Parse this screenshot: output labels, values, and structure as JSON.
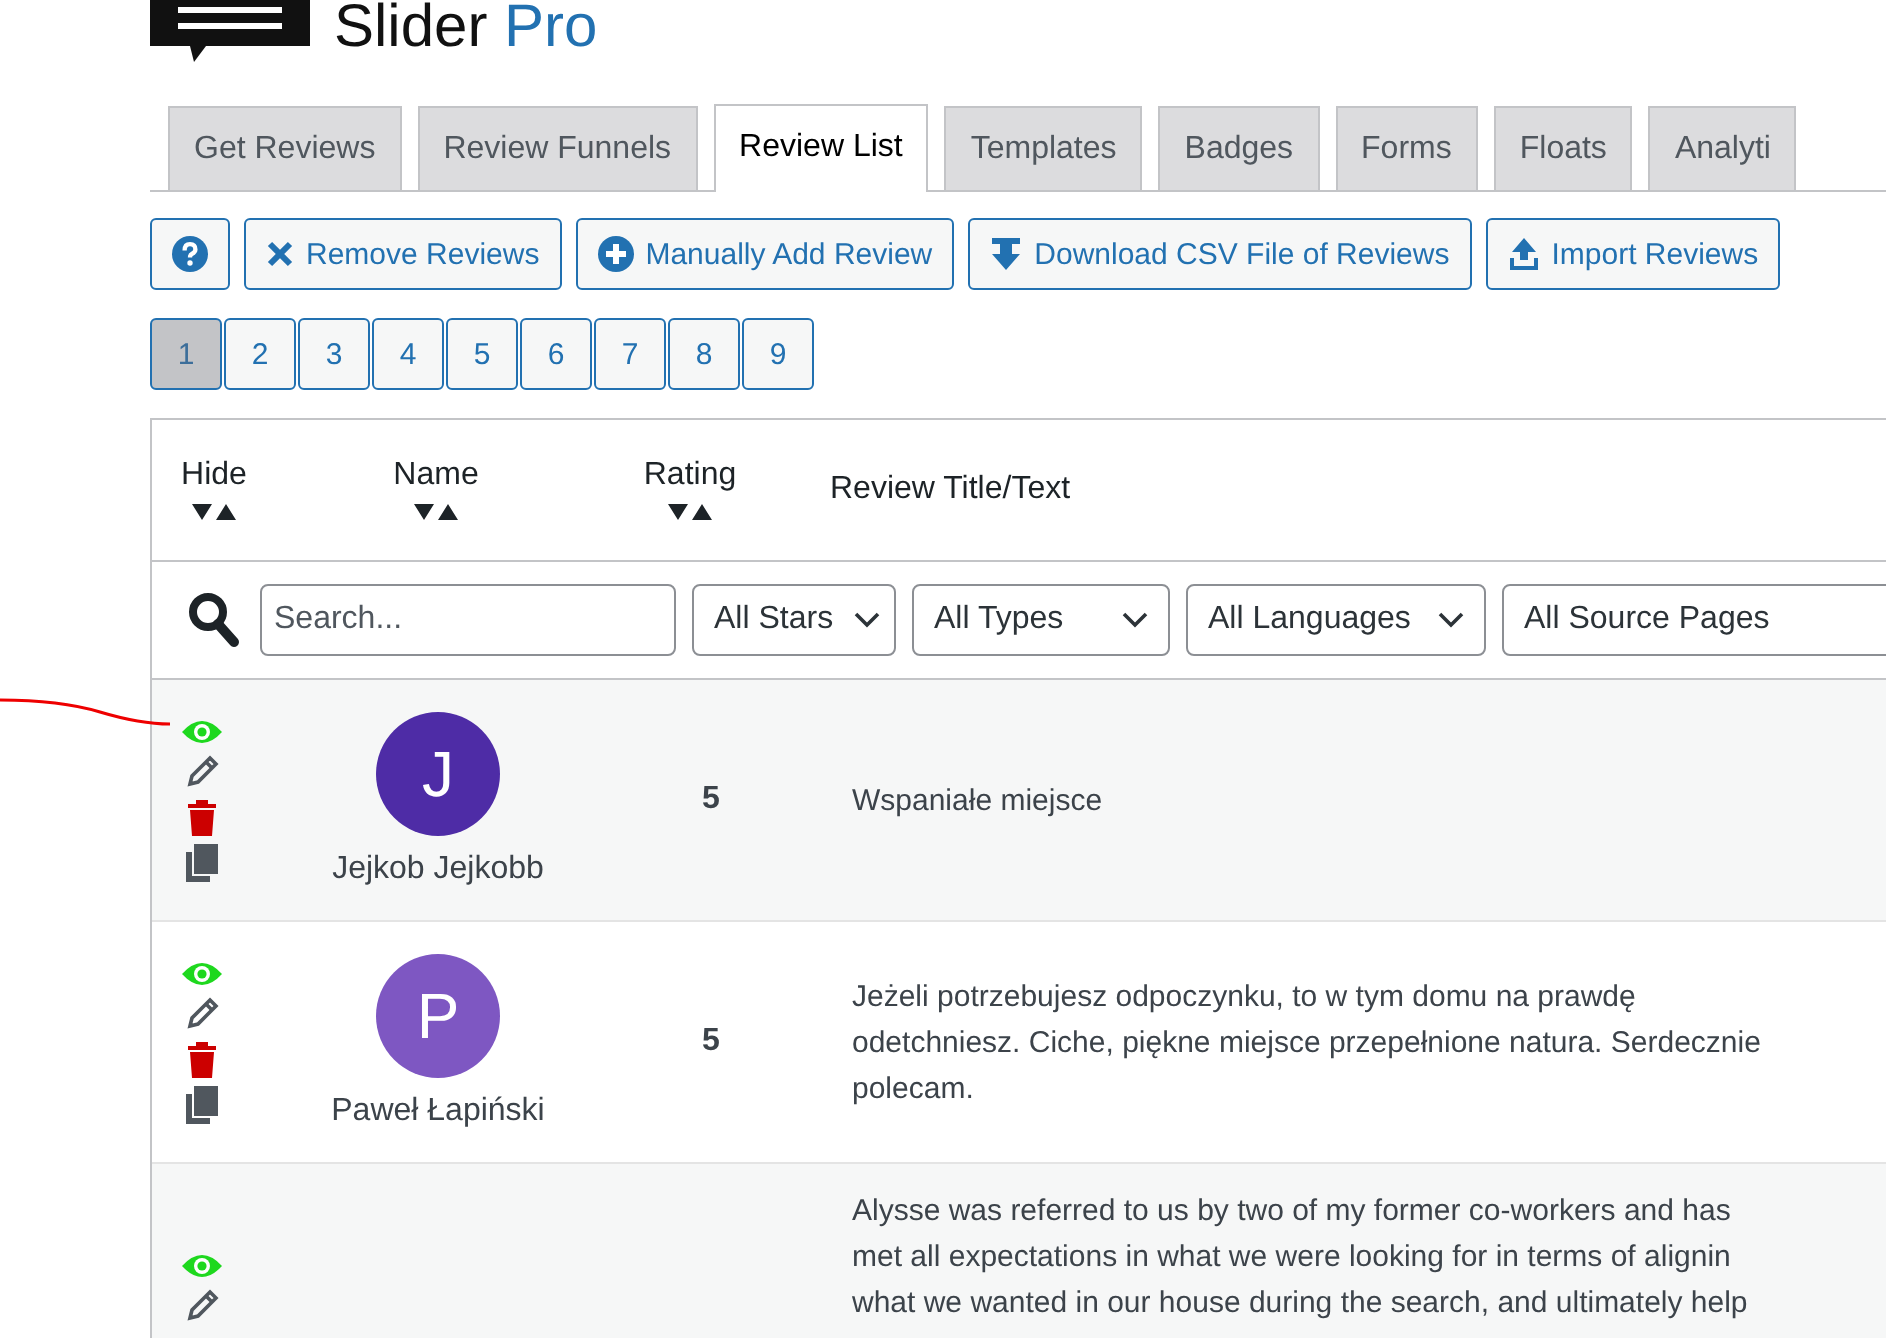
{
  "logo": {
    "name": "Slider",
    "suffix": "Pro"
  },
  "tabs": [
    {
      "label": "Get Reviews",
      "selected": false
    },
    {
      "label": "Review Funnels",
      "selected": false
    },
    {
      "label": "Review List",
      "selected": true
    },
    {
      "label": "Templates",
      "selected": false
    },
    {
      "label": "Badges",
      "selected": false
    },
    {
      "label": "Forms",
      "selected": false
    },
    {
      "label": "Floats",
      "selected": false
    },
    {
      "label": "Analyti",
      "selected": false
    }
  ],
  "toolbar": [
    {
      "kind": "help"
    },
    {
      "kind": "remove",
      "label": "Remove Reviews"
    },
    {
      "kind": "add",
      "label": "Manually Add Review"
    },
    {
      "kind": "download",
      "label": "Download CSV File of Reviews"
    },
    {
      "kind": "import",
      "label": "Import Reviews"
    }
  ],
  "pages": [
    {
      "label": "1",
      "selected": true
    },
    {
      "label": "2",
      "selected": false
    },
    {
      "label": "3",
      "selected": false
    },
    {
      "label": "4",
      "selected": false
    },
    {
      "label": "5",
      "selected": false
    },
    {
      "label": "6",
      "selected": false
    },
    {
      "label": "7",
      "selected": false
    },
    {
      "label": "8",
      "selected": false
    },
    {
      "label": "9",
      "selected": false
    }
  ],
  "table": {
    "columns": [
      {
        "label": "Hide",
        "sortable": true
      },
      {
        "label": "Name",
        "sortable": true
      },
      {
        "label": "Rating",
        "sortable": true
      },
      {
        "label": "Review Title/Text",
        "sortable": false
      }
    ],
    "search": {
      "placeholder": "Search..."
    },
    "filters": [
      {
        "value": "All Stars",
        "caret": true
      },
      {
        "value": "All Types",
        "caret": true
      },
      {
        "value": "All Languages",
        "caret": true
      },
      {
        "value": "All Source Pages",
        "caret": false
      }
    ],
    "rows": [
      {
        "hidden": false,
        "initial": "J",
        "color": "#4e2ca6",
        "name": "Jejkob Jejkobb",
        "rating": "5",
        "text_lines": [
          "Wspaniałe miejsce"
        ]
      },
      {
        "hidden": false,
        "initial": "P",
        "color": "#7e57c2",
        "name": "Paweł Łapiński",
        "rating": "5",
        "text_lines": [
          "Jeżeli potrzebujesz odpoczynku, to w tym domu na prawdę",
          "odetchniesz. Ciche, piękne miejsce przepełnione natura. Serdecznie",
          "polecam."
        ]
      },
      {
        "hidden": false,
        "text_lines": [
          "Alysse was referred to us by two of my former co-workers and has",
          "met all expectations in what we were looking for in terms of alignin",
          "what we wanted in our house during the search, and ultimately help"
        ]
      }
    ]
  }
}
